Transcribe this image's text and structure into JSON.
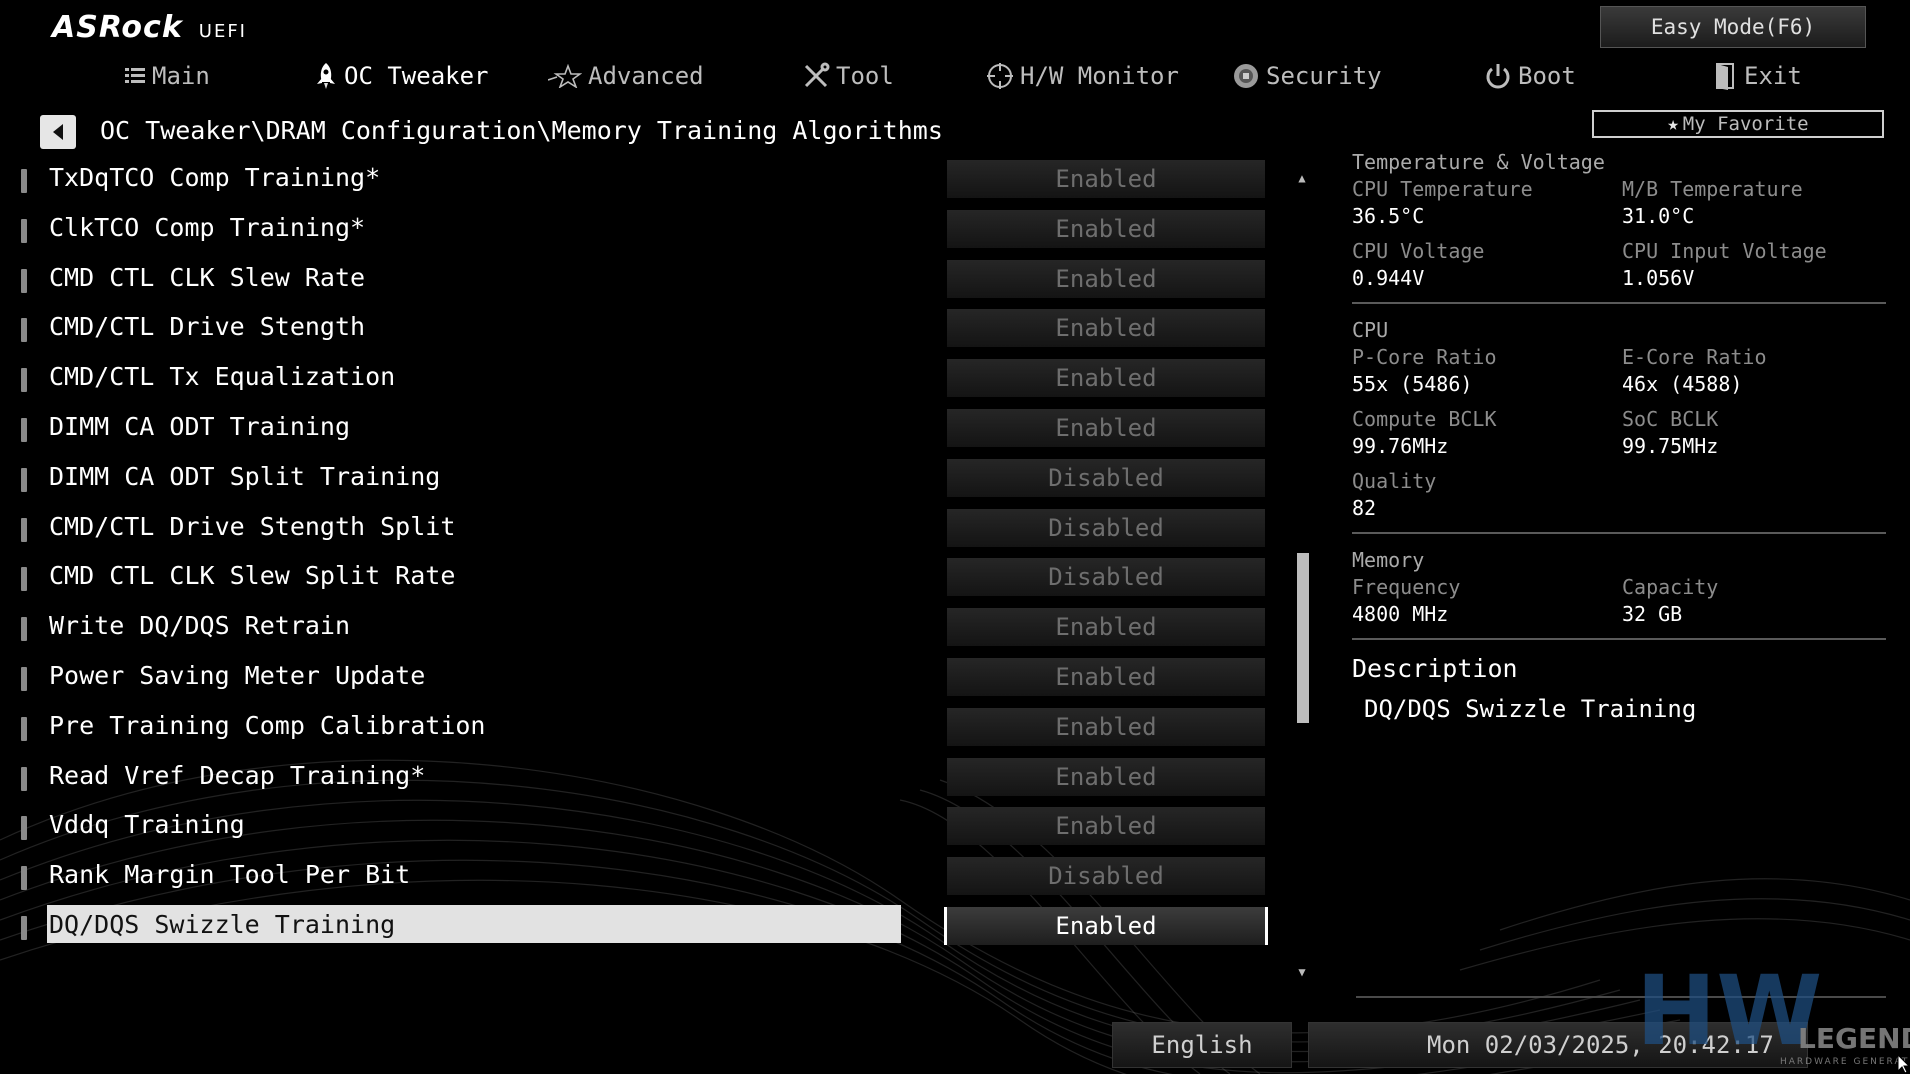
{
  "logo": {
    "brand": "ASRock",
    "sub": "UEFI"
  },
  "header": {
    "easy_mode": "Easy Mode(F6)"
  },
  "nav": [
    {
      "label": "Main",
      "icon": "list-icon"
    },
    {
      "label": "OC Tweaker",
      "icon": "rocket-icon",
      "active": true
    },
    {
      "label": "Advanced",
      "icon": "star-icon"
    },
    {
      "label": "Tool",
      "icon": "tools-icon"
    },
    {
      "label": "H/W Monitor",
      "icon": "crosshair-icon"
    },
    {
      "label": "Security",
      "icon": "shield-icon"
    },
    {
      "label": "Boot",
      "icon": "power-icon"
    },
    {
      "label": "Exit",
      "icon": "exit-door-icon"
    }
  ],
  "breadcrumb": "OC Tweaker\\DRAM Configuration\\Memory Training Algorithms",
  "favorite": "My Favorite",
  "settings": [
    {
      "label": "TxDqTCO Comp Training*",
      "value": "Enabled"
    },
    {
      "label": "ClkTCO Comp Training*",
      "value": "Enabled"
    },
    {
      "label": "CMD CTL CLK Slew Rate",
      "value": "Enabled"
    },
    {
      "label": "CMD/CTL Drive Stength",
      "value": "Enabled"
    },
    {
      "label": "CMD/CTL Tx Equalization",
      "value": "Enabled"
    },
    {
      "label": "DIMM CA ODT Training",
      "value": "Enabled"
    },
    {
      "label": "DIMM CA ODT Split Training",
      "value": "Disabled"
    },
    {
      "label": "CMD/CTL Drive Stength Split",
      "value": "Disabled"
    },
    {
      "label": "CMD CTL CLK Slew Split Rate",
      "value": "Disabled"
    },
    {
      "label": "Write DQ/DQS Retrain",
      "value": "Enabled"
    },
    {
      "label": "Power Saving Meter Update",
      "value": "Enabled"
    },
    {
      "label": "Pre Training Comp Calibration",
      "value": "Enabled"
    },
    {
      "label": "Read Vref Decap Training*",
      "value": "Enabled"
    },
    {
      "label": "Vddq Training",
      "value": "Enabled"
    },
    {
      "label": "Rank Margin Tool Per Bit",
      "value": "Disabled"
    },
    {
      "label": "DQ/DQS Swizzle Training",
      "value": "Enabled",
      "selected": true
    }
  ],
  "monitor": {
    "temp_voltage": {
      "title": "Temperature & Voltage",
      "cpu_temp_label": "CPU Temperature",
      "cpu_temp": "36.5°C",
      "mb_temp_label": "M/B Temperature",
      "mb_temp": "31.0°C",
      "cpu_voltage_label": "CPU Voltage",
      "cpu_voltage": "0.944V",
      "cpu_input_voltage_label": "CPU Input Voltage",
      "cpu_input_voltage": "1.056V"
    },
    "cpu": {
      "title": "CPU",
      "pcore_label": "P-Core Ratio",
      "pcore": "55x (5486)",
      "ecore_label": "E-Core Ratio",
      "ecore": "46x (4588)",
      "compute_bclk_label": "Compute BCLK",
      "compute_bclk": "99.76MHz",
      "soc_bclk_label": "SoC BCLK",
      "soc_bclk": "99.75MHz",
      "quality_label": "Quality",
      "quality": "82"
    },
    "memory": {
      "title": "Memory",
      "frequency_label": "Frequency",
      "frequency": "4800 MHz",
      "capacity_label": "Capacity",
      "capacity": "32 GB"
    }
  },
  "description": {
    "title": "Description",
    "text": "DQ/DQS Swizzle Training"
  },
  "footer": {
    "language": "English",
    "datetime": "Mon 02/03/2025, 20:42:17"
  },
  "watermark": {
    "mark": "HW",
    "text": "LEGEND",
    "sub": "HARDWARE GENERATION"
  },
  "colors": {
    "background": "#000000",
    "highlight": "#e2e2e2",
    "text": "#ffffff",
    "disabled_text": "#6e6e6e"
  }
}
